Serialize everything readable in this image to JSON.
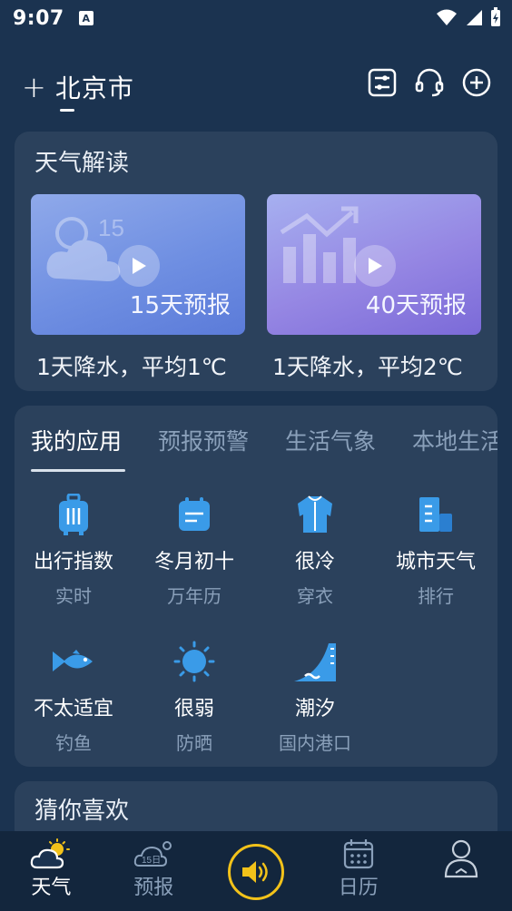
{
  "status": {
    "time": "9:07",
    "a_badge": "A"
  },
  "header": {
    "plus": "+",
    "city": "北京市"
  },
  "interpretation": {
    "title": "天气解读",
    "cards": [
      {
        "label": "15天预报",
        "caption": "1天降水，平均1℃",
        "decor_text": "15"
      },
      {
        "label": "40天预报",
        "caption": "1天降水，平均2℃"
      }
    ]
  },
  "apps": {
    "tabs": [
      "我的应用",
      "预报预警",
      "生活气象",
      "本地生活"
    ],
    "items": [
      {
        "title": "出行指数",
        "sub": "实时",
        "icon": "luggage-icon"
      },
      {
        "title": "冬月初十",
        "sub": "万年历",
        "icon": "calendar-icon"
      },
      {
        "title": "很冷",
        "sub": "穿衣",
        "icon": "jacket-icon"
      },
      {
        "title": "城市天气",
        "sub": "排行",
        "icon": "building-icon"
      },
      {
        "title": "不太适宜",
        "sub": "钓鱼",
        "icon": "fish-icon"
      },
      {
        "title": "很弱",
        "sub": "防晒",
        "icon": "sun-icon"
      },
      {
        "title": "潮汐",
        "sub": "国内港口",
        "icon": "tide-icon"
      }
    ]
  },
  "guess": {
    "title": "猜你喜欢"
  },
  "nav": {
    "items": [
      {
        "label": "天气",
        "icon": "weather-icon"
      },
      {
        "label": "预报",
        "icon": "forecast-15day-icon",
        "icon_text": "15日"
      },
      {
        "label": "",
        "icon": "speaker-icon"
      },
      {
        "label": "日历",
        "icon": "calendar-icon"
      },
      {
        "label": "",
        "icon": "profile-icon"
      }
    ]
  },
  "colors": {
    "background": "#1b3350",
    "accent": "#f2c21a",
    "icon_blue": "#3a9be8",
    "muted": "#8aa0ba"
  }
}
